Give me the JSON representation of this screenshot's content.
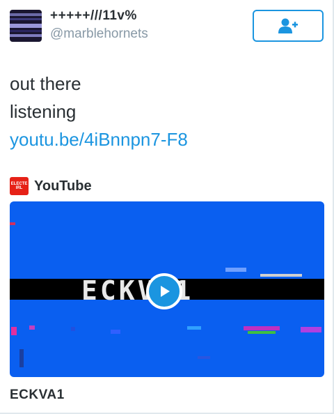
{
  "user": {
    "name": "+++++///11v%",
    "handle": "@marblehornets"
  },
  "follow_button": {
    "icon": "add-user-icon"
  },
  "tweet": {
    "lines": [
      "out there",
      "listening"
    ],
    "link": "youtu.be/4iBnnpn7-F8"
  },
  "card": {
    "source_logo_text": "ELECTE IRL",
    "source_name": "YouTube",
    "video_overlay_text": "ECKVA1",
    "title": "ECKVA1"
  },
  "colors": {
    "accent": "#1b95e0",
    "video_background": "#0a5ff0",
    "source_logo": "#e62117",
    "text": "#292f33",
    "muted": "#8899a6"
  }
}
